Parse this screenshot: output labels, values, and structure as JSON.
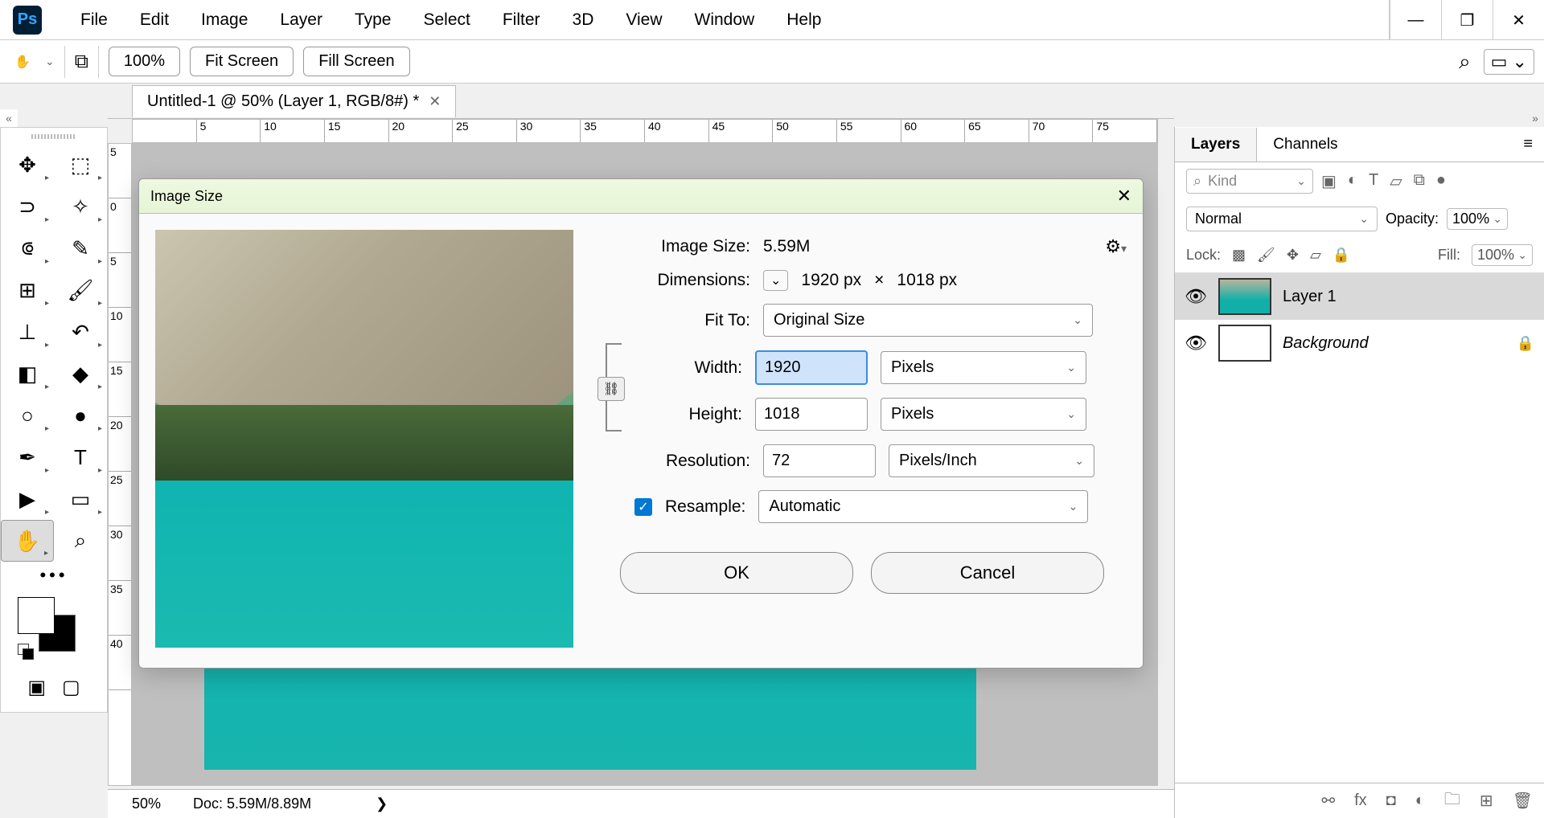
{
  "app": {
    "logo": "Ps"
  },
  "menu": [
    "File",
    "Edit",
    "Image",
    "Layer",
    "Type",
    "Select",
    "Filter",
    "3D",
    "View",
    "Window",
    "Help"
  ],
  "options": {
    "zoom": "100%",
    "fit_screen": "Fit Screen",
    "fill_screen": "Fill Screen"
  },
  "document": {
    "tab_title": "Untitled-1 @ 50% (Layer 1, RGB/8#) *",
    "ruler_h": [
      "",
      "5",
      "10",
      "15",
      "20",
      "25",
      "30",
      "35",
      "40",
      "45",
      "50",
      "55",
      "60",
      "65",
      "70",
      "75"
    ],
    "ruler_v": [
      "5",
      "0",
      "5",
      "10",
      "15",
      "20",
      "25",
      "30",
      "35",
      "40"
    ],
    "status_zoom": "50%",
    "status_doc": "Doc: 5.59M/8.89M"
  },
  "panels": {
    "tabs": [
      "Layers",
      "Channels"
    ],
    "kind_placeholder": "Kind",
    "blend_mode": "Normal",
    "opacity_label": "Opacity:",
    "opacity_value": "100%",
    "lock_label": "Lock:",
    "fill_label": "Fill:",
    "fill_value": "100%",
    "layers": [
      {
        "name": "Layer 1",
        "selected": true,
        "has_image": true,
        "locked": false
      },
      {
        "name": "Background",
        "selected": false,
        "has_image": false,
        "locked": true,
        "italic": true
      }
    ]
  },
  "dialog": {
    "title": "Image Size",
    "image_size_label": "Image Size:",
    "image_size_value": "5.59M",
    "dimensions_label": "Dimensions:",
    "dim_w": "1920 px",
    "dim_sep": "×",
    "dim_h": "1018 px",
    "fit_to_label": "Fit To:",
    "fit_to_value": "Original Size",
    "width_label": "Width:",
    "width_value": "1920",
    "width_unit": "Pixels",
    "height_label": "Height:",
    "height_value": "1018",
    "height_unit": "Pixels",
    "resolution_label": "Resolution:",
    "resolution_value": "72",
    "resolution_unit": "Pixels/Inch",
    "resample_label": "Resample:",
    "resample_value": "Automatic",
    "ok": "OK",
    "cancel": "Cancel"
  }
}
